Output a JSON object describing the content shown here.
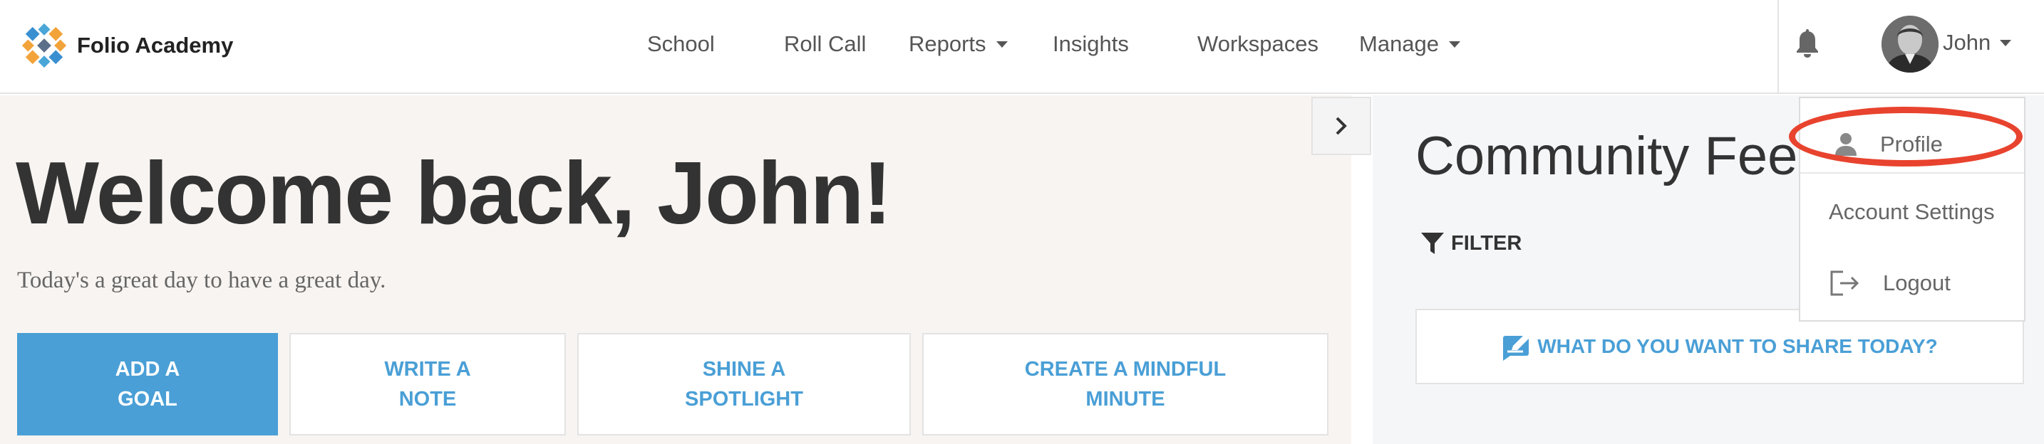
{
  "brand": {
    "name": "Folio Academy"
  },
  "nav": {
    "items": [
      {
        "label": "School"
      },
      {
        "label": "Roll Call"
      },
      {
        "label": "Reports",
        "has_dropdown": true
      },
      {
        "label": "Insights"
      },
      {
        "label": "Workspaces"
      },
      {
        "label": "Manage",
        "has_dropdown": true
      }
    ]
  },
  "user": {
    "name": "John",
    "avatar": "avatar-photo"
  },
  "main": {
    "welcome": "Welcome back, John!",
    "subtitle": "Today's a great day to have a great day.",
    "actions": [
      {
        "line1": "ADD A",
        "line2": "GOAL",
        "primary": true
      },
      {
        "line1": "WRITE A",
        "line2": "NOTE"
      },
      {
        "line1": "SHINE A",
        "line2": "SPOTLIGHT"
      },
      {
        "line1": "CREATE A MINDFUL",
        "line2": "MINUTE"
      }
    ]
  },
  "feed": {
    "title": "Community Feed",
    "filter_label": "FILTER",
    "share_prompt": "WHAT DO YOU WANT TO SHARE TODAY?"
  },
  "user_menu": {
    "items": [
      {
        "label": "Profile",
        "icon": "person-icon",
        "highlighted": true
      },
      {
        "label": "Account Settings"
      },
      {
        "label": "Logout",
        "icon": "logout-icon"
      }
    ]
  },
  "colors": {
    "accent": "#4a9fd6",
    "highlight": "#e8432e",
    "main_bg": "#f8f4f1",
    "feed_bg": "#f5f6f8"
  }
}
